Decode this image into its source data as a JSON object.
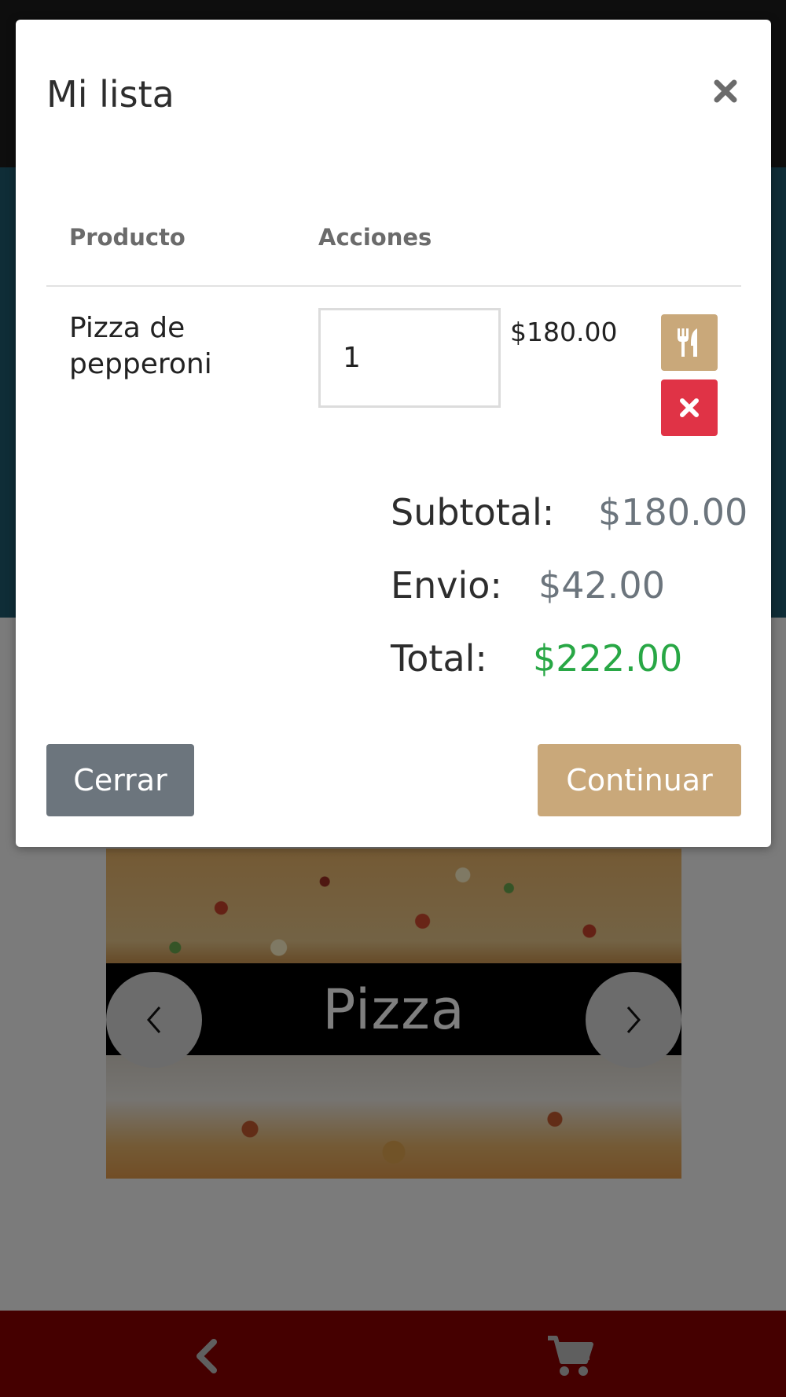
{
  "background": {
    "carousel": {
      "caption": "Pizza",
      "prev_icon": "chevron-left-icon",
      "next_icon": "chevron-right-icon"
    },
    "bottom_nav": {
      "back_icon": "chevron-left-icon",
      "cart_icon": "cart-icon",
      "color": "#8b0000"
    }
  },
  "modal": {
    "title": "Mi lista",
    "close_icon": "close-icon",
    "table": {
      "headers": [
        "Producto",
        "Acciones"
      ],
      "rows": [
        {
          "product": "Pizza de pepperoni",
          "quantity": "1",
          "price": "$180.00",
          "menu_icon": "utensils-icon",
          "delete_icon": "times-icon"
        }
      ]
    },
    "summary": {
      "subtotal_label": "Subtotal:",
      "subtotal_value": "$180.00",
      "shipping_label": "Envio:",
      "shipping_value": "$42.00",
      "total_label": "Total:",
      "total_value": "$222.00"
    },
    "buttons": {
      "close_label": "Cerrar",
      "continue_label": "Continuar"
    },
    "colors": {
      "accent": "#c9a87a",
      "danger": "#e03346",
      "secondary": "#6c757d",
      "success": "#28a745"
    }
  }
}
